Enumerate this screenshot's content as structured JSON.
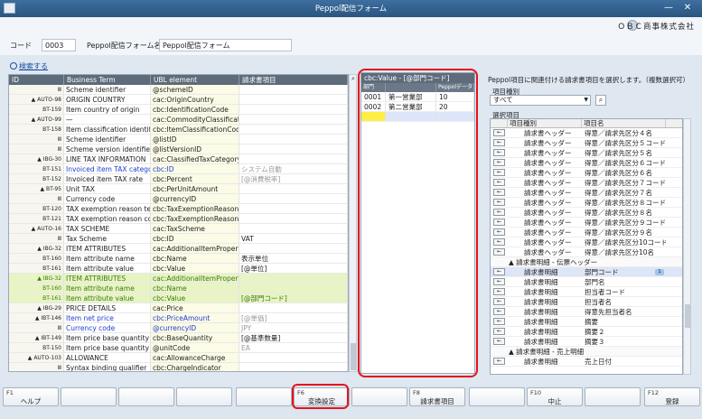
{
  "window": {
    "title": "Peppol配信フォーム",
    "company": "ＯＢＣ商事株式会社"
  },
  "form": {
    "code_label": "コード",
    "code_value": "0003",
    "name_label": "Peppol配信フォーム名",
    "name_value": "Peppol配信フォーム",
    "search_link": "検索する"
  },
  "left_table": {
    "headers": [
      "ID",
      "Business Term",
      "UBL element",
      "請求書項目"
    ],
    "rows": [
      {
        "id": "Ⅲ",
        "bt": "Scheme identifier",
        "ubl": "@schemeID",
        "inv": "",
        "style": ""
      },
      {
        "id": "▲ AUTO-98",
        "bt": "ORIGIN COUNTRY",
        "ubl": "cac:OriginCountry",
        "inv": "",
        "style": ""
      },
      {
        "id": "BT-159",
        "bt": "Item country of origin",
        "ubl": "cbc:IdentificationCode",
        "inv": "",
        "style": ""
      },
      {
        "id": "▲ AUTO-99",
        "bt": "—",
        "ubl": "cac:CommodityClassification",
        "inv": "",
        "style": ""
      },
      {
        "id": "BT-158",
        "bt": "Item classification identifier",
        "ubl": "cbc:ItemClassificationCode",
        "inv": "",
        "style": ""
      },
      {
        "id": "Ⅲ",
        "bt": "Scheme identifier",
        "ubl": "@listID",
        "inv": "",
        "style": ""
      },
      {
        "id": "Ⅲ",
        "bt": "Scheme version identifier",
        "ubl": "@listVersionID",
        "inv": "",
        "style": ""
      },
      {
        "id": "▲ IBG-30",
        "bt": "LINE TAX INFORMATION",
        "ubl": "cac:ClassifiedTaxCategory",
        "inv": "",
        "style": ""
      },
      {
        "id": "BT-151",
        "bt": "Invoiced item TAX category code",
        "ubl": "cbc:ID",
        "inv": "システム自動",
        "style": "blue gray"
      },
      {
        "id": "BT-152",
        "bt": "Invoiced item TAX rate",
        "ubl": "cbc:Percent",
        "inv": "[@消費税率]",
        "style": "gray"
      },
      {
        "id": "▲ BT-95",
        "bt": "Unit TAX",
        "ubl": "cbc:PerUnitAmount",
        "inv": "",
        "style": ""
      },
      {
        "id": "Ⅲ",
        "bt": "Currency code",
        "ubl": "@currencyID",
        "inv": "",
        "style": ""
      },
      {
        "id": "BT-120",
        "bt": "TAX exemption reason text",
        "ubl": "cbc:TaxExemptionReasonCode",
        "inv": "",
        "style": ""
      },
      {
        "id": "BT-121",
        "bt": "TAX exemption reason code",
        "ubl": "cbc:TaxExemptionReason",
        "inv": "",
        "style": ""
      },
      {
        "id": "▲ AUTO-16",
        "bt": "TAX SCHEME",
        "ubl": "cac:TaxScheme",
        "inv": "",
        "style": ""
      },
      {
        "id": "Ⅲ",
        "bt": "Tax Scheme",
        "ubl": "cbc:ID",
        "inv": "VAT",
        "style": ""
      },
      {
        "id": "▲ IBG-32",
        "bt": "ITEM ATTRIBUTES",
        "ubl": "cac:AdditionalItemProperty",
        "inv": "",
        "style": ""
      },
      {
        "id": "BT-160",
        "bt": "Item attribute name",
        "ubl": "cbc:Name",
        "inv": "表示単位",
        "style": ""
      },
      {
        "id": "BT-161",
        "bt": "Item attribute value",
        "ubl": "cbc:Value",
        "inv": "[@単位]",
        "style": ""
      },
      {
        "id": "▲ IBG-32",
        "bt": "ITEM ATTRIBUTES",
        "ubl": "cac:AdditionalItemProperty",
        "inv": "",
        "style": "green"
      },
      {
        "id": "BT-160",
        "bt": "Item attribute name",
        "ubl": "cbc:Name",
        "inv": "",
        "style": "green"
      },
      {
        "id": "BT-161",
        "bt": "Item attribute value",
        "ubl": "cbc:Value",
        "inv": "[@部門コード]",
        "style": "green"
      },
      {
        "id": "▲ IBG-29",
        "bt": "PRICE DETAILS",
        "ubl": "cac:Price",
        "inv": "",
        "style": ""
      },
      {
        "id": "▲ IBT-146",
        "bt": "Item net price",
        "ubl": "cbc:PriceAmount",
        "inv": "[@単価]",
        "style": "blue gray"
      },
      {
        "id": "Ⅲ",
        "bt": "Currency code",
        "ubl": "@currencyID",
        "inv": "JPY",
        "style": "blue gray"
      },
      {
        "id": "▲ IBT-149",
        "bt": "Item price base quantity",
        "ubl": "cbc:BaseQuantity",
        "inv": "[@基準数量]",
        "style": ""
      },
      {
        "id": "BT-150",
        "bt": "Item price base quantity unit of measure code",
        "ubl": "@unitCode",
        "inv": "EA",
        "style": "gray"
      },
      {
        "id": "▲ AUTO-103",
        "bt": "ALLOWANCE",
        "ubl": "cac:AllowanceCharge",
        "inv": "",
        "style": ""
      },
      {
        "id": "Ⅲ",
        "bt": "Syntax binding qualifier",
        "ubl": "cbc:ChargeIndicator",
        "inv": "",
        "style": ""
      }
    ]
  },
  "mid_panel": {
    "title": "cbc:Value - [@部門コード]",
    "headers": [
      "部門",
      "",
      "Peppolデータ"
    ],
    "rows": [
      {
        "c1": "0001",
        "c2": "第一営業部",
        "c3": "10",
        "sel": false
      },
      {
        "c1": "0002",
        "c2": "第二営業部",
        "c3": "20",
        "sel": false
      },
      {
        "c1": "",
        "c2": "",
        "c3": "",
        "sel": true
      }
    ]
  },
  "right_panel": {
    "instruction": "Peppol項目に関連付ける請求書項目を選択します。（複数選択可）",
    "type_label": "項目種別",
    "type_value": "すべて",
    "select_label": "選択項目",
    "headers": [
      "項目種別",
      "項目名"
    ],
    "rows": [
      {
        "kind": "請求書ヘッダー",
        "name": "得意／請求先区分４名",
        "type": "item"
      },
      {
        "kind": "請求書ヘッダー",
        "name": "得意／請求先区分５コード",
        "type": "item"
      },
      {
        "kind": "請求書ヘッダー",
        "name": "得意／請求先区分５名",
        "type": "item"
      },
      {
        "kind": "請求書ヘッダー",
        "name": "得意／請求先区分６コード",
        "type": "item"
      },
      {
        "kind": "請求書ヘッダー",
        "name": "得意／請求先区分６名",
        "type": "item"
      },
      {
        "kind": "請求書ヘッダー",
        "name": "得意／請求先区分７コード",
        "type": "item"
      },
      {
        "kind": "請求書ヘッダー",
        "name": "得意／請求先区分７名",
        "type": "item"
      },
      {
        "kind": "請求書ヘッダー",
        "name": "得意／請求先区分８コード",
        "type": "item"
      },
      {
        "kind": "請求書ヘッダー",
        "name": "得意／請求先区分８名",
        "type": "item"
      },
      {
        "kind": "請求書ヘッダー",
        "name": "得意／請求先区分９コード",
        "type": "item"
      },
      {
        "kind": "請求書ヘッダー",
        "name": "得意／請求先区分９名",
        "type": "item"
      },
      {
        "kind": "請求書ヘッダー",
        "name": "得意／請求先区分10コード",
        "type": "item"
      },
      {
        "kind": "請求書ヘッダー",
        "name": "得意／請求先区分10名",
        "type": "item"
      },
      {
        "kind": "▲ 請求書明細 - 伝票ヘッダー",
        "name": "",
        "type": "group"
      },
      {
        "kind": "請求書明細",
        "name": "部門コード",
        "type": "item",
        "badge": "1",
        "hl": true
      },
      {
        "kind": "請求書明細",
        "name": "部門名",
        "type": "item"
      },
      {
        "kind": "請求書明細",
        "name": "担当者コード",
        "type": "item"
      },
      {
        "kind": "請求書明細",
        "name": "担当者名",
        "type": "item"
      },
      {
        "kind": "請求書明細",
        "name": "得意先担当者名",
        "type": "item"
      },
      {
        "kind": "請求書明細",
        "name": "摘要",
        "type": "item"
      },
      {
        "kind": "請求書明細",
        "name": "摘要２",
        "type": "item"
      },
      {
        "kind": "請求書明細",
        "name": "摘要３",
        "type": "item"
      },
      {
        "kind": "▲ 請求書明細 - 売上明細",
        "name": "",
        "type": "group"
      },
      {
        "kind": "請求書明細",
        "name": "売上日付",
        "type": "item"
      }
    ]
  },
  "function_keys": [
    {
      "key": "F1",
      "label": "ヘルプ"
    },
    {
      "key": "",
      "label": ""
    },
    {
      "key": "",
      "label": ""
    },
    {
      "key": "",
      "label": ""
    },
    {
      "key": "",
      "label": ""
    },
    {
      "key": "F6",
      "label": "変換設定"
    },
    {
      "key": "",
      "label": ""
    },
    {
      "key": "F8",
      "label": "請求書項目"
    },
    {
      "key": "",
      "label": ""
    },
    {
      "key": "F10",
      "label": "中止"
    },
    {
      "key": "",
      "label": ""
    },
    {
      "key": "F12",
      "label": "登録"
    }
  ],
  "colors": {
    "highlight_frame": "#e4141b",
    "header_bg": "#5d6b7a",
    "title_bar": "#2a5580"
  }
}
